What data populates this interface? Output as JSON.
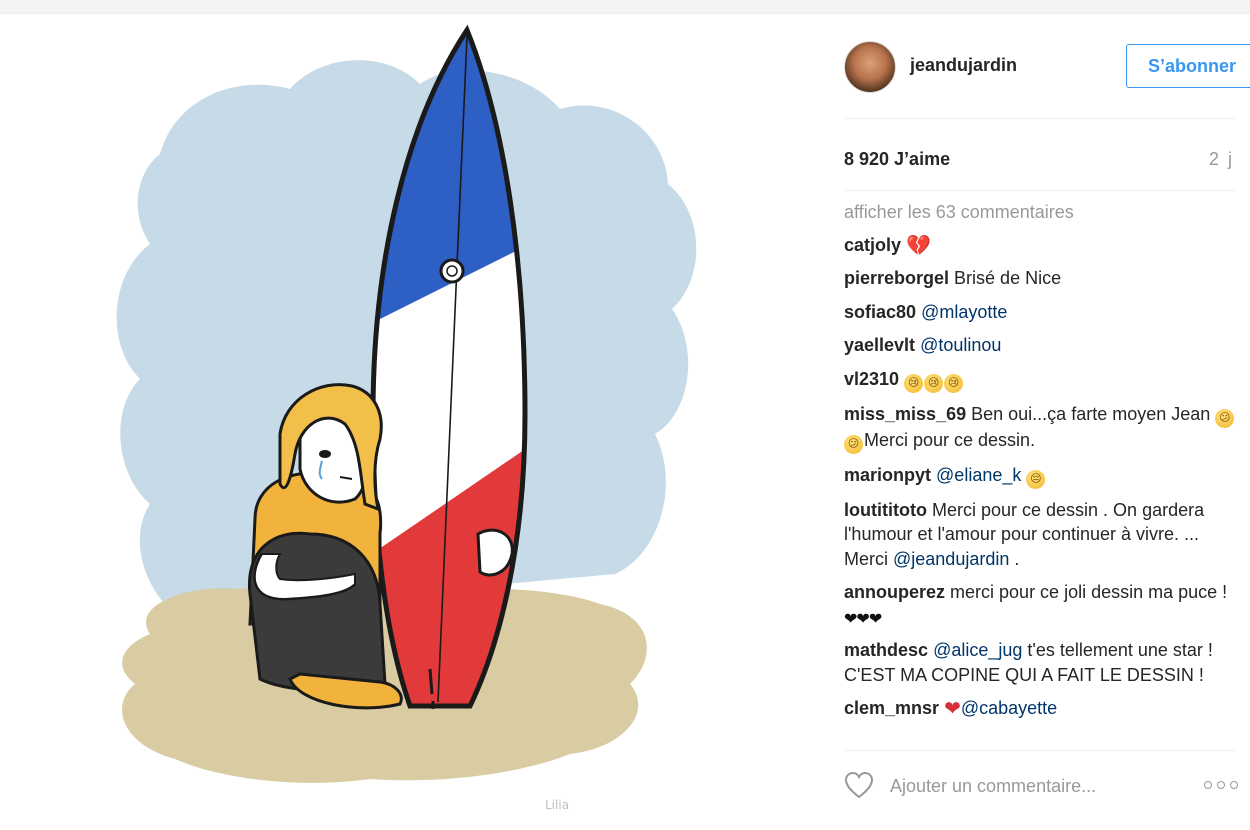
{
  "post": {
    "username": "jeandujardin",
    "follow_label": "S’abonner",
    "likes": "8 920 J’aime",
    "time": "2 j",
    "show_all_label": "afficher les 63 commentaires",
    "comments": [
      {
        "user": "catjoly",
        "parts": [
          {
            "type": "emoji",
            "kind": "heart",
            "text": "💔"
          }
        ]
      },
      {
        "user": "pierreborgel",
        "parts": [
          {
            "type": "text",
            "text": "Brisé de Nice"
          }
        ]
      },
      {
        "user": "sofiac80",
        "parts": [
          {
            "type": "mention",
            "text": "@mlayotte"
          }
        ]
      },
      {
        "user": "yaellevlt",
        "parts": [
          {
            "type": "mention",
            "text": "@toulinou"
          }
        ]
      },
      {
        "user": "vl2310",
        "parts": [
          {
            "type": "emoji",
            "kind": "face",
            "text": "😢"
          },
          {
            "type": "emoji",
            "kind": "face",
            "text": "😢"
          },
          {
            "type": "emoji",
            "kind": "face",
            "text": "😢"
          }
        ]
      },
      {
        "user": "miss_miss_69",
        "parts": [
          {
            "type": "text",
            "text": "Ben oui...ça farte moyen Jean "
          },
          {
            "type": "emoji",
            "kind": "face",
            "text": "😕"
          },
          {
            "type": "emoji",
            "kind": "face",
            "text": "😕"
          },
          {
            "type": "text",
            "text": "Merci pour ce dessin."
          }
        ]
      },
      {
        "user": "marionpyt",
        "parts": [
          {
            "type": "mention",
            "text": "@eliane_k"
          },
          {
            "type": "text",
            "text": " "
          },
          {
            "type": "emoji",
            "kind": "face",
            "text": "😔"
          }
        ]
      },
      {
        "user": "loutititoto",
        "parts": [
          {
            "type": "text",
            "text": "Merci pour ce dessin . On gardera l'humour et l'amour pour continuer à vivre. ... Merci "
          },
          {
            "type": "mention",
            "text": "@jeandujardin"
          },
          {
            "type": "text",
            "text": " ."
          }
        ]
      },
      {
        "user": "annouperez",
        "parts": [
          {
            "type": "text",
            "text": "merci pour ce joli dessin ma puce ! "
          },
          {
            "type": "emoji",
            "kind": "black",
            "text": "❤❤❤"
          }
        ]
      },
      {
        "user": "mathdesc",
        "parts": [
          {
            "type": "mention",
            "text": "@alice_jug"
          },
          {
            "type": "text",
            "text": " t'es tellement une star ! C'EST MA COPINE QUI A FAIT LE DESSIN !"
          }
        ]
      },
      {
        "user": "clem_mnsr",
        "parts": [
          {
            "type": "emoji",
            "kind": "heart",
            "text": "❤"
          },
          {
            "type": "mention",
            "text": "@cabayette"
          }
        ]
      }
    ],
    "add_comment_placeholder": "Ajouter un commentaire..."
  },
  "illustration": {
    "signature": "Lilia",
    "icons": [
      "surfboard-illustration",
      "crying-girl-illustration"
    ]
  }
}
